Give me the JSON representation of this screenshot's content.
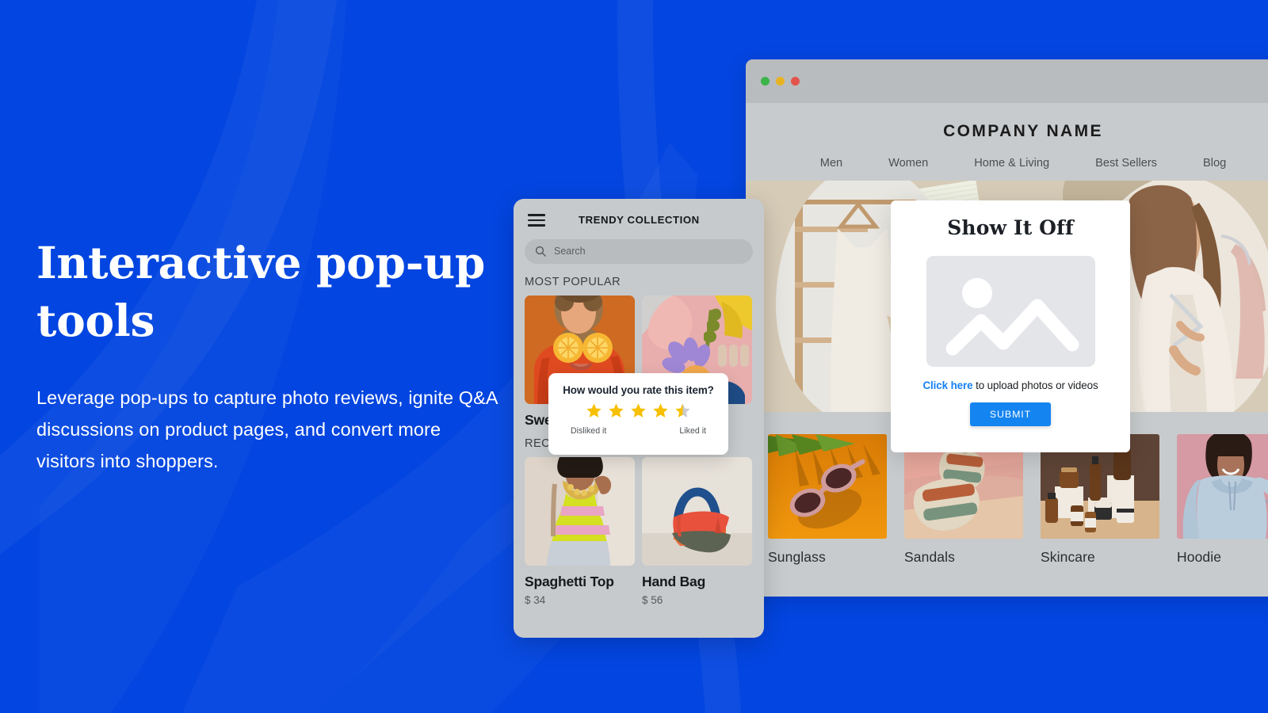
{
  "theme": {
    "background_blue": "#0345E0",
    "accent_blue": "#1484f0",
    "star_gold": "#F7C000",
    "star_grey": "#C9CBCD"
  },
  "hero": {
    "title": "Interactive pop-up tools",
    "subtitle": "Leverage pop-ups to capture photo reviews, ignite Q&A discussions on product pages, and convert more visitors into shoppers."
  },
  "browser": {
    "traffic_lights": [
      "green",
      "yellow",
      "red"
    ],
    "brand": "COMPANY NAME",
    "nav": [
      "Men",
      "Women",
      "Home & Living",
      "Best Sellers",
      "Blog"
    ],
    "products": [
      {
        "label": "Sunglass"
      },
      {
        "label": "Sandals"
      },
      {
        "label": "Skincare"
      },
      {
        "label": "Hoodie"
      }
    ]
  },
  "phone": {
    "menu_icon": "hamburger-icon",
    "title": "TRENDY COLLECTION",
    "search": {
      "icon": "search-icon",
      "placeholder": "Search",
      "value": ""
    },
    "sections": [
      {
        "title": "MOST POPULAR",
        "items": [
          {
            "name": "Sweater",
            "price": ""
          },
          {
            "name": "",
            "price": ""
          }
        ]
      },
      {
        "title": "RECENTLY PURCHASED",
        "items": [
          {
            "name": "Spaghetti Top",
            "price": "$ 34"
          },
          {
            "name": "Hand Bag",
            "price": "$ 56"
          }
        ]
      }
    ]
  },
  "rating_popup": {
    "question": "How would you rate this item?",
    "rating": 4.5,
    "max_rating": 5,
    "low_label": "Disliked it",
    "high_label": "Liked it"
  },
  "showoff_modal": {
    "title": "Show It Off",
    "placeholder_icon": "image-placeholder-icon",
    "link_text": "Click here",
    "hint_text": " to upload photos or videos",
    "submit_label": "SUBMIT"
  }
}
